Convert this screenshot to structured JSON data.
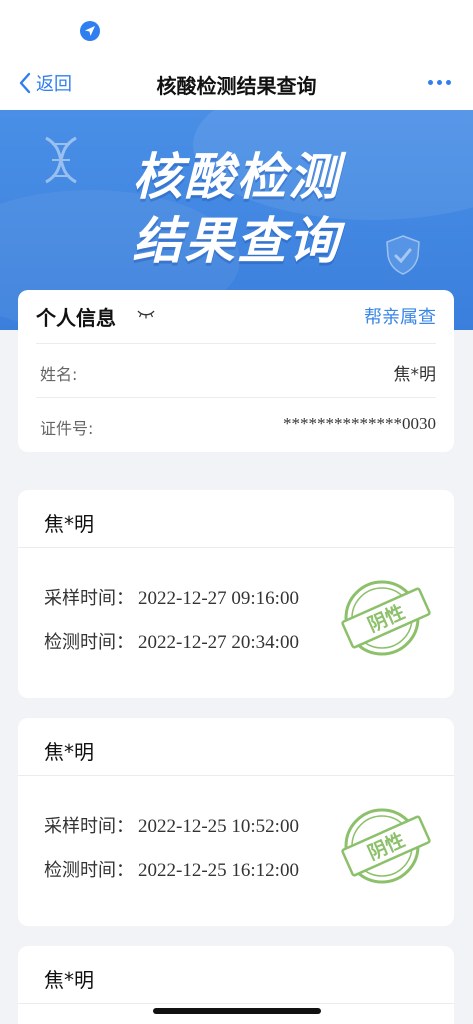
{
  "nav": {
    "back_label": "返回",
    "title": "核酸检测结果查询"
  },
  "banner": {
    "line1": "核酸检测",
    "line2": "结果查询"
  },
  "personal_info": {
    "title": "个人信息",
    "relative_link": "帮亲属查",
    "name_label": "姓名:",
    "name_value": "焦*明",
    "id_label": "证件号:",
    "id_value": "**************0030"
  },
  "results": [
    {
      "name": "焦*明",
      "sample_label": "采样时间：",
      "sample_time": "2022-12-27 09:16:00",
      "test_label": "检测时间：",
      "test_time": "2022-12-27 20:34:00",
      "stamp_text": "阴性"
    },
    {
      "name": "焦*明",
      "sample_label": "采样时间：",
      "sample_time": "2022-12-25 10:52:00",
      "test_label": "检测时间：",
      "test_time": "2022-12-25 16:12:00",
      "stamp_text": "阴性"
    },
    {
      "name": "焦*明"
    }
  ],
  "colors": {
    "accent": "#2f7ff0",
    "banner": "#3a7fdc",
    "stamp_green": "#8cc06a"
  }
}
